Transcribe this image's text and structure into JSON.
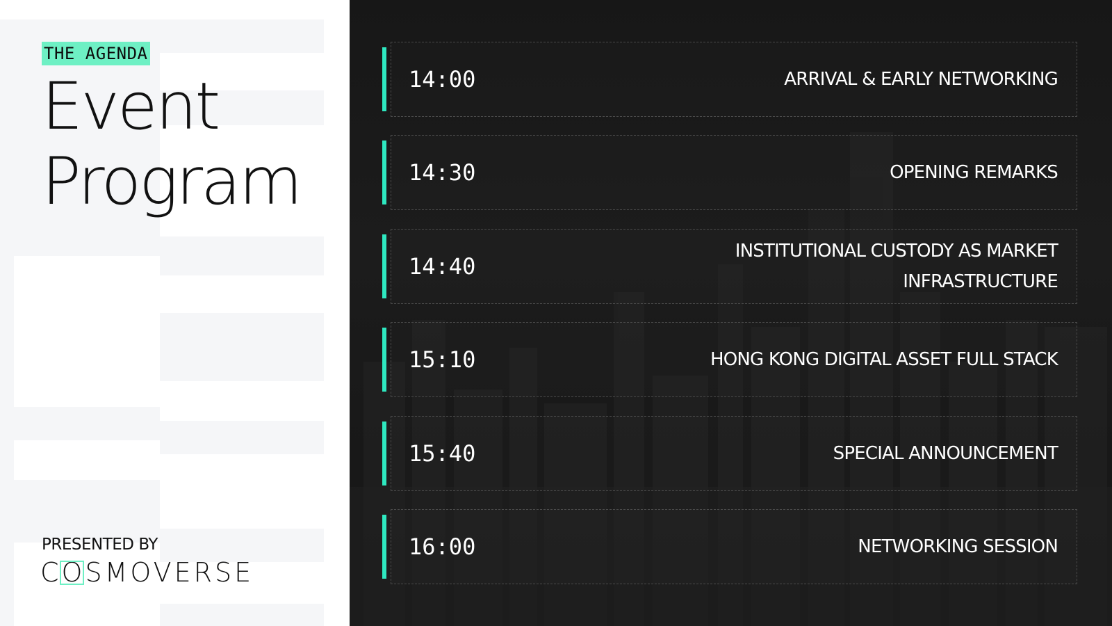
{
  "sidebar": {
    "eyebrow": "THE AGENDA",
    "title_line1": "Event",
    "title_line2": "Program",
    "presented_by": "PRESENTED BY",
    "brand": {
      "before": "C",
      "framed": "O",
      "after": "SMOVERSE"
    }
  },
  "agenda": [
    {
      "time": "14:00",
      "title": "ARRIVAL & EARLY NETWORKING"
    },
    {
      "time": "14:30",
      "title": "OPENING REMARKS"
    },
    {
      "time": "14:40",
      "title": "INSTITUTIONAL CUSTODY AS MARKET INFRASTRUCTURE"
    },
    {
      "time": "15:10",
      "title": "HONG KONG DIGITAL ASSET FULL STACK"
    },
    {
      "time": "15:40",
      "title": "SPECIAL ANNOUNCEMENT"
    },
    {
      "time": "16:00",
      "title": "NETWORKING SESSION"
    }
  ],
  "colors": {
    "accent": "#2ee8c0",
    "highlight": "#6ef0c4",
    "panel_dark": "#1a1a1a",
    "text_light": "#ffffff",
    "text_dark": "#111111"
  }
}
